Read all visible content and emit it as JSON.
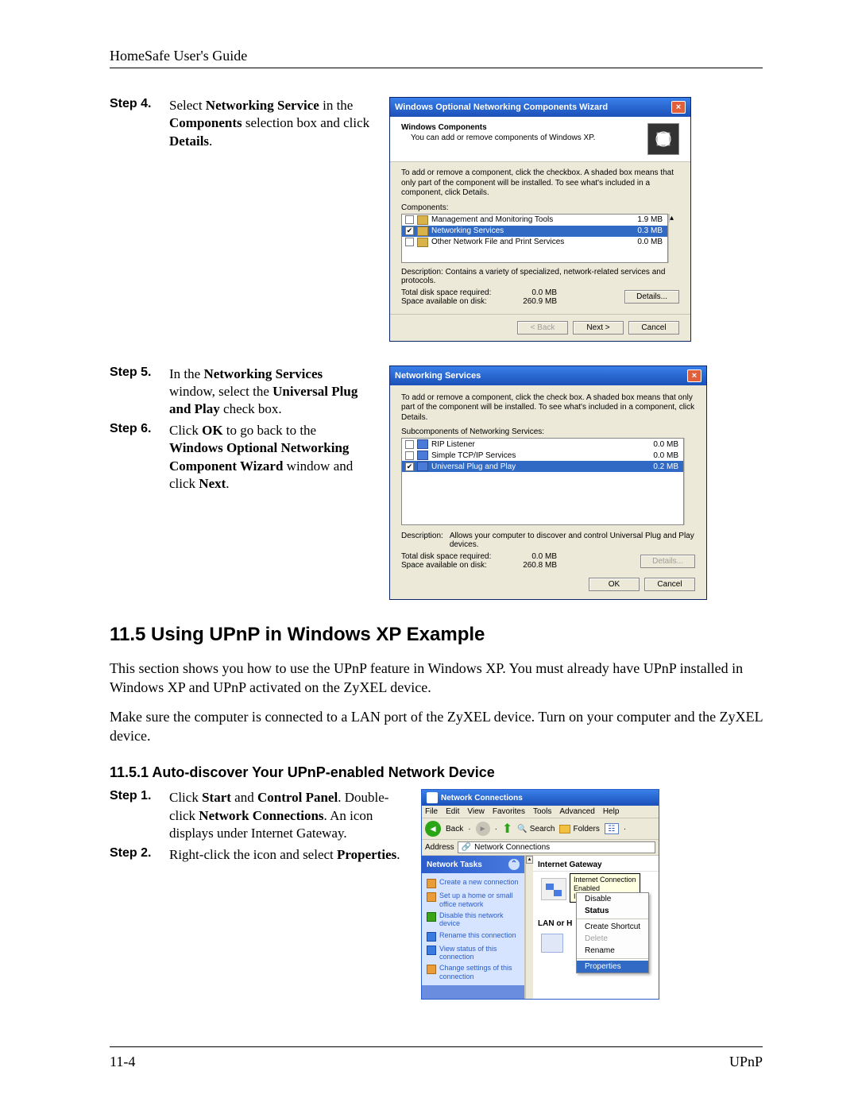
{
  "header": {
    "title": "HomeSafe User's Guide"
  },
  "stepsA": {
    "step4": {
      "label": "Step 4.",
      "text_pre": "Select ",
      "bold1": "Networking Service",
      "text_mid1": " in the ",
      "bold2": "Components",
      "text_mid2": " selection box and click ",
      "bold3": "Details",
      "text_end": "."
    }
  },
  "dialog1": {
    "title": "Windows Optional Networking Components Wizard",
    "subhead": "Windows Components",
    "subtext": "You can add or remove components of Windows XP.",
    "instruction": "To add or remove a component, click the checkbox. A shaded box means that only part of the component will be installed. To see what's included in a component, click Details.",
    "components_label": "Components:",
    "rows": [
      {
        "name": "Management and Monitoring Tools",
        "size": "1.9 MB",
        "checked": false,
        "selected": false
      },
      {
        "name": "Networking Services",
        "size": "0.3 MB",
        "checked": true,
        "selected": true
      },
      {
        "name": "Other Network File and Print Services",
        "size": "0.0 MB",
        "checked": false,
        "selected": false
      }
    ],
    "description": "Description:  Contains a variety of specialized, network-related services and protocols.",
    "disk_req_label": "Total disk space required:",
    "disk_req_val": "0.0 MB",
    "disk_avail_label": "Space available on disk:",
    "disk_avail_val": "260.9 MB",
    "btn_details": "Details...",
    "btn_back": "< Back",
    "btn_next": "Next >",
    "btn_cancel": "Cancel"
  },
  "stepsB": {
    "step5": {
      "label": "Step 5.",
      "p1": "In the ",
      "b1": "Networking Services",
      "p2": " window, select the ",
      "b2": "Universal Plug and Play",
      "p3": " check box."
    },
    "step6": {
      "label": "Step 6.",
      "p1": "Click ",
      "b1": "OK",
      "p2": " to go back to the ",
      "b2": "Windows Optional Networking Component Wizard",
      "p3": " window and click ",
      "b3": "Next",
      "p4": "."
    }
  },
  "dialog2": {
    "title": "Networking Services",
    "instruction": "To add or remove a component, click the check box. A shaded box means that only part of the component will be installed. To see what's included in a component, click Details.",
    "sub_label": "Subcomponents of Networking Services:",
    "rows": [
      {
        "name": "RIP Listener",
        "size": "0.0 MB",
        "checked": false,
        "selected": false
      },
      {
        "name": "Simple TCP/IP Services",
        "size": "0.0 MB",
        "checked": false,
        "selected": false
      },
      {
        "name": "Universal Plug and Play",
        "size": "0.2 MB",
        "checked": true,
        "selected": true
      }
    ],
    "desc_label": "Description:",
    "desc_text": "Allows your computer to discover and control Universal Plug and Play devices.",
    "disk_req_label": "Total disk space required:",
    "disk_req_val": "0.0 MB",
    "disk_avail_label": "Space available on disk:",
    "disk_avail_val": "260.8 MB",
    "btn_details": "Details...",
    "btn_ok": "OK",
    "btn_cancel": "Cancel"
  },
  "section": {
    "title": "11.5  Using UPnP in Windows XP Example",
    "para1": "This section shows you how to use the UPnP feature in Windows XP. You must already have UPnP installed in Windows XP and UPnP activated on the ZyXEL device.",
    "para2": "Make sure the computer is connected to a LAN port of the ZyXEL device. Turn on your computer and the ZyXEL device.",
    "sub_title": "11.5.1 Auto-discover Your UPnP-enabled Network Device"
  },
  "stepsC": {
    "step1": {
      "label": "Step 1.",
      "p1": "Click ",
      "b1": "Start",
      "p2": " and ",
      "b2": "Control Panel",
      "p3": ". Double-click ",
      "b3": "Network Connections",
      "p4": ". An icon displays under Internet Gateway."
    },
    "step2": {
      "label": "Step 2.",
      "p1": "Right-click the icon and select ",
      "b1": "Properties",
      "p2": "."
    }
  },
  "ncwin": {
    "title": "Network Connections",
    "menu": [
      "File",
      "Edit",
      "View",
      "Favorites",
      "Tools",
      "Advanced",
      "Help"
    ],
    "tb_back": "Back",
    "tb_search": "Search",
    "tb_folders": "Folders",
    "addr_label": "Address",
    "addr_val": "Network Connections",
    "tasks_head": "Network Tasks",
    "tasks": [
      "Create a new connection",
      "Set up a home or small office network",
      "Disable this network device",
      "Rename this connection",
      "View status of this connection",
      "Change settings of this connection"
    ],
    "ig_head": "Internet Gateway",
    "tooltip_l1": "Internet Connection",
    "tooltip_l2": "Enabled",
    "tooltip_l3": "Internet Connection",
    "cm": {
      "disable": "Disable",
      "status": "Status",
      "shortcut": "Create Shortcut",
      "delete": "Delete",
      "rename": "Rename",
      "properties": "Properties"
    },
    "lan_head": "LAN or H"
  },
  "footer": {
    "left": "11-4",
    "right": "UPnP"
  }
}
